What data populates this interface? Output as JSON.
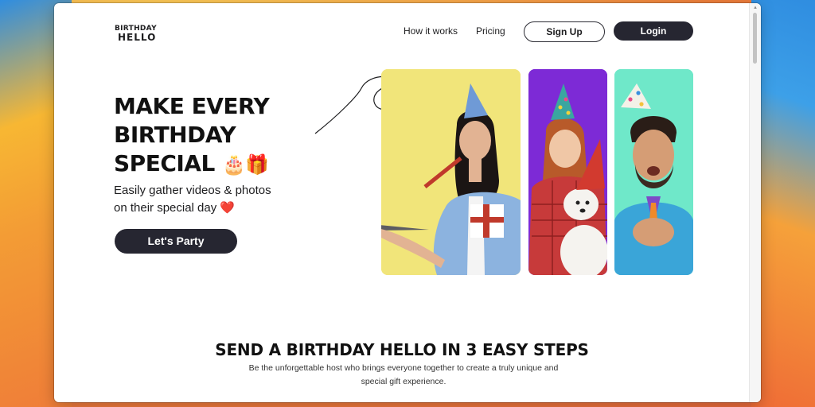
{
  "brand": {
    "logo_line1": "BIRTHDAY",
    "logo_line2": "HELLO"
  },
  "nav": {
    "how_it_works": "How it works",
    "pricing": "Pricing",
    "signup": "Sign Up",
    "login": "Login"
  },
  "hero": {
    "title_line1": "MAKE EVERY",
    "title_line2": "BIRTHDAY",
    "title_line3": "SPECIAL",
    "title_emoji": "🎂🎁",
    "subtitle_line1": "Easily gather videos & photos",
    "subtitle_line2": "on their special day",
    "subtitle_heart": "❤️",
    "cta": "Let's Party"
  },
  "steps": {
    "title": "SEND A BIRTHDAY HELLO IN 3 EASY STEPS",
    "subtitle_line1": "Be the unforgettable host who brings everyone together to create a truly unique and",
    "subtitle_line2": "special gift experience."
  },
  "colors": {
    "dark_button": "#262631",
    "photo1_bg": "#f1e57a",
    "photo2_bg": "#7d2ad6",
    "photo3_bg": "#6fe8c9"
  }
}
